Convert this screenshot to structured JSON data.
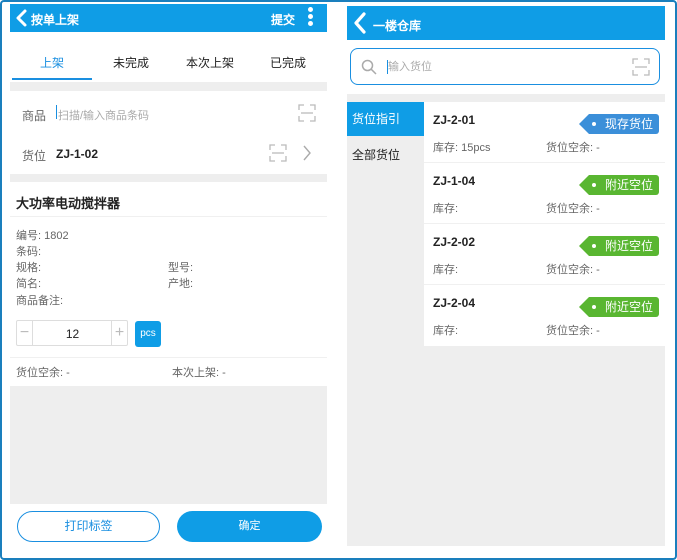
{
  "left": {
    "header": {
      "title": "按单上架",
      "submit_label": "提交"
    },
    "tabs": [
      {
        "label": "上架",
        "active": true
      },
      {
        "label": "未完成",
        "active": false
      },
      {
        "label": "本次上架",
        "active": false
      },
      {
        "label": "已完成",
        "active": false
      }
    ],
    "goods_row": {
      "label": "商品",
      "placeholder": "扫描/输入商品条码"
    },
    "location_row": {
      "label": "货位",
      "value": "ZJ-1-02"
    },
    "product": {
      "name": "大功率电动搅拌器",
      "code": "编号: 1802",
      "barcode": "条码:",
      "spec": "规格:",
      "model": "型号:",
      "short_name": "简名:",
      "origin": "产地:",
      "remark": "商品备注:"
    },
    "quantity": {
      "minus": "−",
      "value": "12",
      "plus": "+",
      "unit": "pcs"
    },
    "space_left": "货位空余: -",
    "this_shelved": "本次上架: -",
    "buttons": {
      "print_label": "打印标签",
      "confirm_label": "确定"
    }
  },
  "right": {
    "header": {
      "title": "一楼仓库"
    },
    "search": {
      "placeholder": "输入货位"
    },
    "sidebar": [
      {
        "label": "货位指引",
        "active": true
      },
      {
        "label": "全部货位",
        "active": false
      }
    ],
    "locations": [
      {
        "code": "ZJ-2-01",
        "stock": "库存: 15pcs",
        "space": "货位空余: -",
        "tag": "现存货位",
        "tag_color": "#3b8fd9"
      },
      {
        "code": "ZJ-1-04",
        "stock": "库存:",
        "space": "货位空余: -",
        "tag": "附近空位",
        "tag_color": "#59b631"
      },
      {
        "code": "ZJ-2-02",
        "stock": "库存:",
        "space": "货位空余: -",
        "tag": "附近空位",
        "tag_color": "#59b631"
      },
      {
        "code": "ZJ-2-04",
        "stock": "库存:",
        "space": "货位空余: -",
        "tag": "附近空位",
        "tag_color": "#59b631"
      }
    ]
  },
  "colors": {
    "primary": "#0f9de6",
    "tab_active": "#1a8fe0",
    "tag_blue": "#3b8fd9",
    "tag_green": "#59b631",
    "frame": "#1a7fbd"
  }
}
